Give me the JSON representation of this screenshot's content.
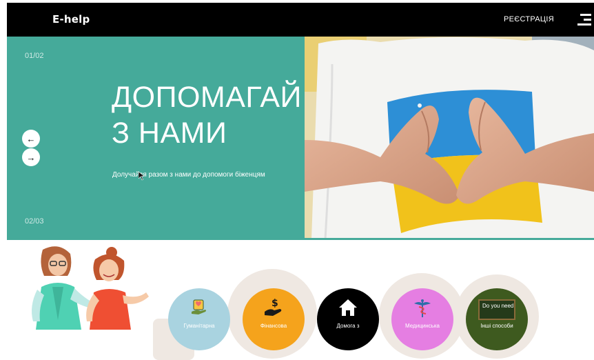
{
  "header": {
    "logo": "E-help",
    "register_label": "РЕЄСТРАЦІЯ"
  },
  "hero": {
    "slide_current": "01/02",
    "slide_next": "02/03",
    "title_line1": "ДОПОМАГАЙ",
    "title_line2": "З НАМИ",
    "subtitle": "Долучайся разом з нами до допомоги біженцям",
    "accent_color": "#45aa9a"
  },
  "categories": [
    {
      "label": "Гуманітарна",
      "color": "#a9d3e0",
      "icon": "hand-heart-icon"
    },
    {
      "label": "Фінансова",
      "color": "#f5a31c",
      "icon": "money-hand-icon"
    },
    {
      "label": "Домога з",
      "color": "#000000",
      "icon": "house-icon"
    },
    {
      "label": "Медицинська",
      "color": "#e57ee2",
      "icon": "caduceus-icon"
    },
    {
      "label": "Інші способи",
      "color": "#3e5a1f",
      "icon": "chalkboard-icon",
      "board_text": "Do you need help?"
    }
  ]
}
